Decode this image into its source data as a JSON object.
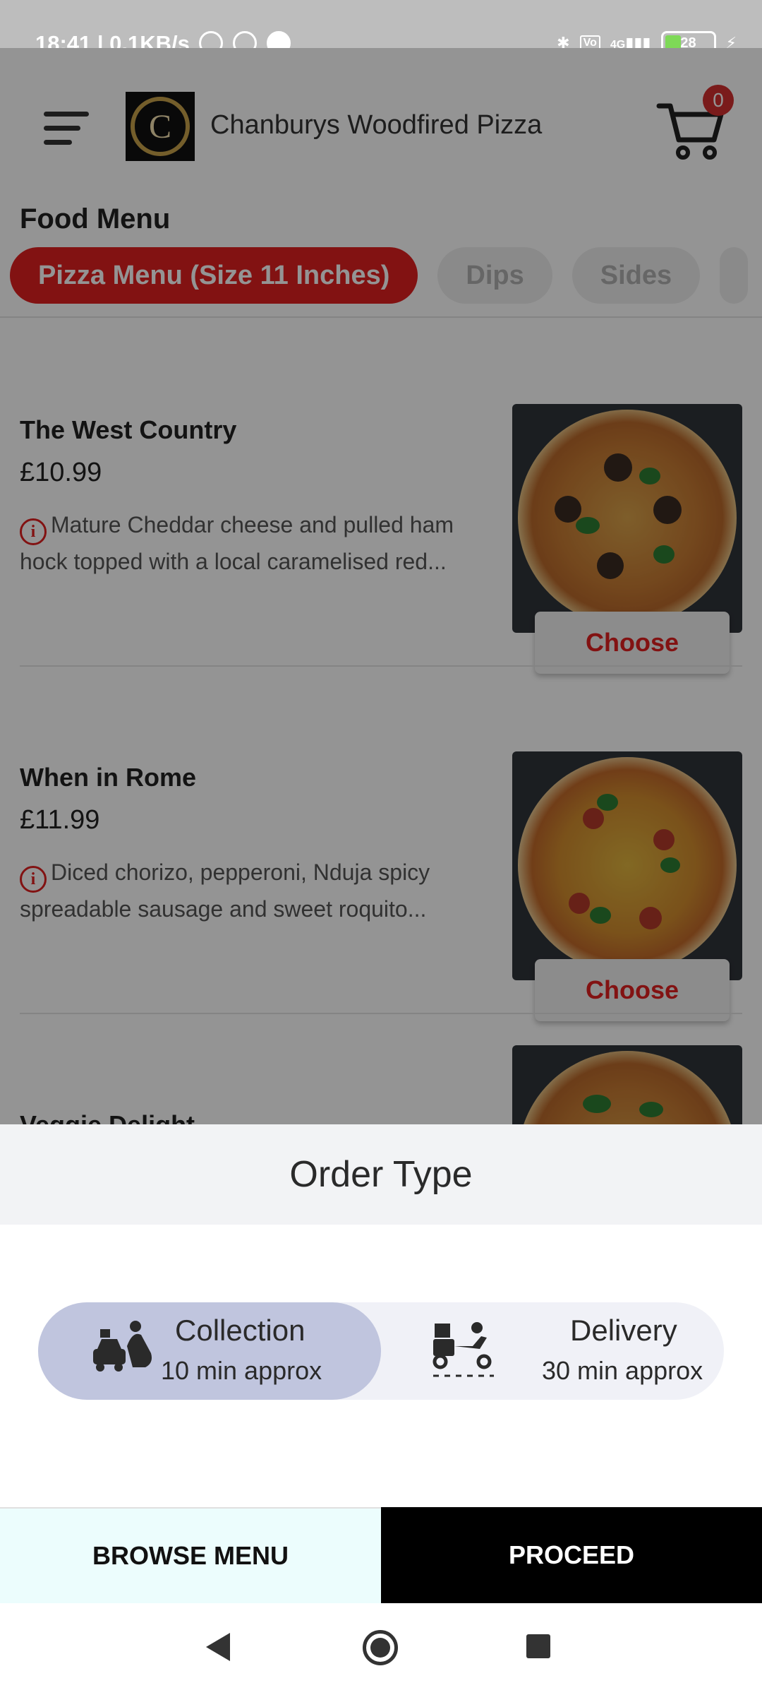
{
  "status_bar": {
    "time": "18:41 | 0.1KB/s",
    "battery": "28",
    "network": "4G"
  },
  "header": {
    "brand_name": "Chanburys Woodfired Pizza",
    "logo_letter": "C",
    "cart_count": "0"
  },
  "menu": {
    "title": "Food Menu",
    "categories": [
      {
        "label": "Pizza Menu (Size 11 Inches)",
        "active": true
      },
      {
        "label": "Dips",
        "active": false
      },
      {
        "label": "Sides",
        "active": false
      }
    ],
    "items": [
      {
        "name": "The West Country",
        "price": "£10.99",
        "description": "Mature Cheddar cheese and pulled ham hock topped with a local caramelised red...",
        "button": "Choose"
      },
      {
        "name": "When in Rome",
        "price": "£11.99",
        "description": "Diced chorizo, pepperoni, Nduja spicy spreadable sausage and sweet roquito...",
        "button": "Choose"
      },
      {
        "name": "Veggie Delight",
        "price": "",
        "description": "",
        "button": ""
      }
    ]
  },
  "order_sheet": {
    "title": "Order Type",
    "options": [
      {
        "label": "Collection",
        "time": "10 min approx",
        "icon": "car-collection-icon",
        "selected": true
      },
      {
        "label": "Delivery",
        "time": "30 min approx",
        "icon": "scooter-delivery-icon",
        "selected": false
      }
    ],
    "browse_label": "BROWSE MENU",
    "proceed_label": "PROCEED"
  },
  "colors": {
    "accent": "#e02020",
    "selected_option": "#c0c5de",
    "proceed_bg": "#000000"
  }
}
